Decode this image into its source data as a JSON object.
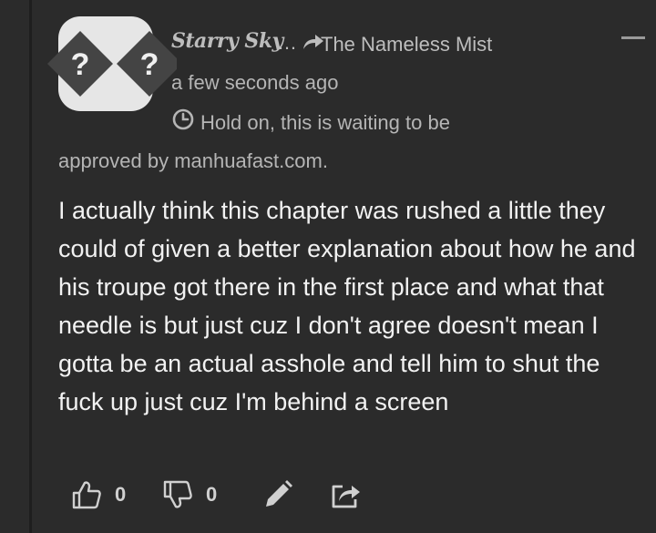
{
  "comment": {
    "author": "Starry Sky",
    "reply_arrow": "…",
    "reply_to": "The Nameless Mist",
    "timestamp": "a few seconds ago",
    "pending_line1": "Hold on, this is waiting to be",
    "pending_line2": "approved by manhuafast.com.",
    "body": "I actually think this chapter was rushed a little they could of given a better explanation about how he and his troupe got there in the first place and what that needle is but just cuz I don't agree doesn't mean I gotta be an actual asshole and tell him to shut the fuck up just cuz I'm behind a screen",
    "avatar_glyphs": [
      "?",
      "?"
    ],
    "upvotes": "0",
    "downvotes": "0"
  },
  "icons": {
    "collapse": "minus-icon",
    "pending": "clock-icon",
    "upvote": "thumbs-up-icon",
    "downvote": "thumbs-down-icon",
    "edit": "pencil-icon",
    "share": "share-icon"
  },
  "colors": {
    "background": "#2b2b2b",
    "text_primary": "#f2f2f2",
    "text_secondary": "#b5b5b5",
    "avatar_bg": "#e6e6e6",
    "avatar_diamond": "#444444"
  }
}
